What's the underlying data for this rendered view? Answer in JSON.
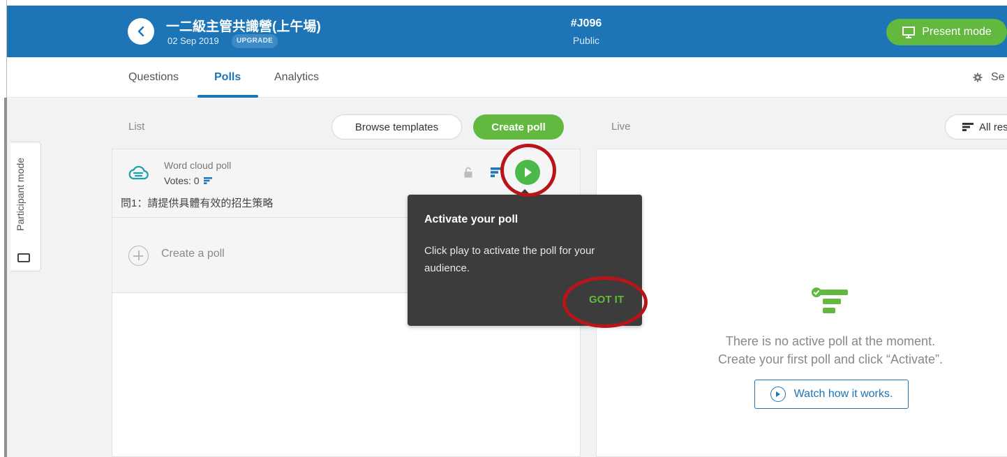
{
  "header": {
    "back_label": "‹",
    "event_title": "一二級主管共識營(上午場)",
    "event_date": "02 Sep 2019",
    "upgrade_badge": "UPGRADE",
    "event_code": "#J096",
    "visibility": "Public",
    "present_mode_label": "Present mode"
  },
  "tabs": [
    {
      "label": "Questions",
      "active": false
    },
    {
      "label": "Polls",
      "active": true
    },
    {
      "label": "Analytics",
      "active": false
    }
  ],
  "settings_label": "Se",
  "participant_mode_label": "Participant mode",
  "toolbar": {
    "list_label": "List",
    "browse_templates_label": "Browse templates",
    "create_poll_label": "Create poll",
    "live_label": "Live",
    "all_results_label": "All res"
  },
  "poll": {
    "type": "Word cloud poll",
    "votes": "Votes: 0",
    "question": "問1：請提供具體有效的招生策略"
  },
  "create_row_label": "Create a poll",
  "tooltip": {
    "title": "Activate your poll",
    "body": "Click play to activate the poll for your audience.",
    "confirm_label": "GOT IT"
  },
  "live_empty": {
    "line1": "There is no active poll at the moment.",
    "line2": "Create your first poll and click “Activate”.",
    "watch_label": "Watch how it works."
  },
  "colors": {
    "header_blue": "#1d74b6",
    "green": "#63b93f",
    "annotation_red": "#b8141a"
  }
}
